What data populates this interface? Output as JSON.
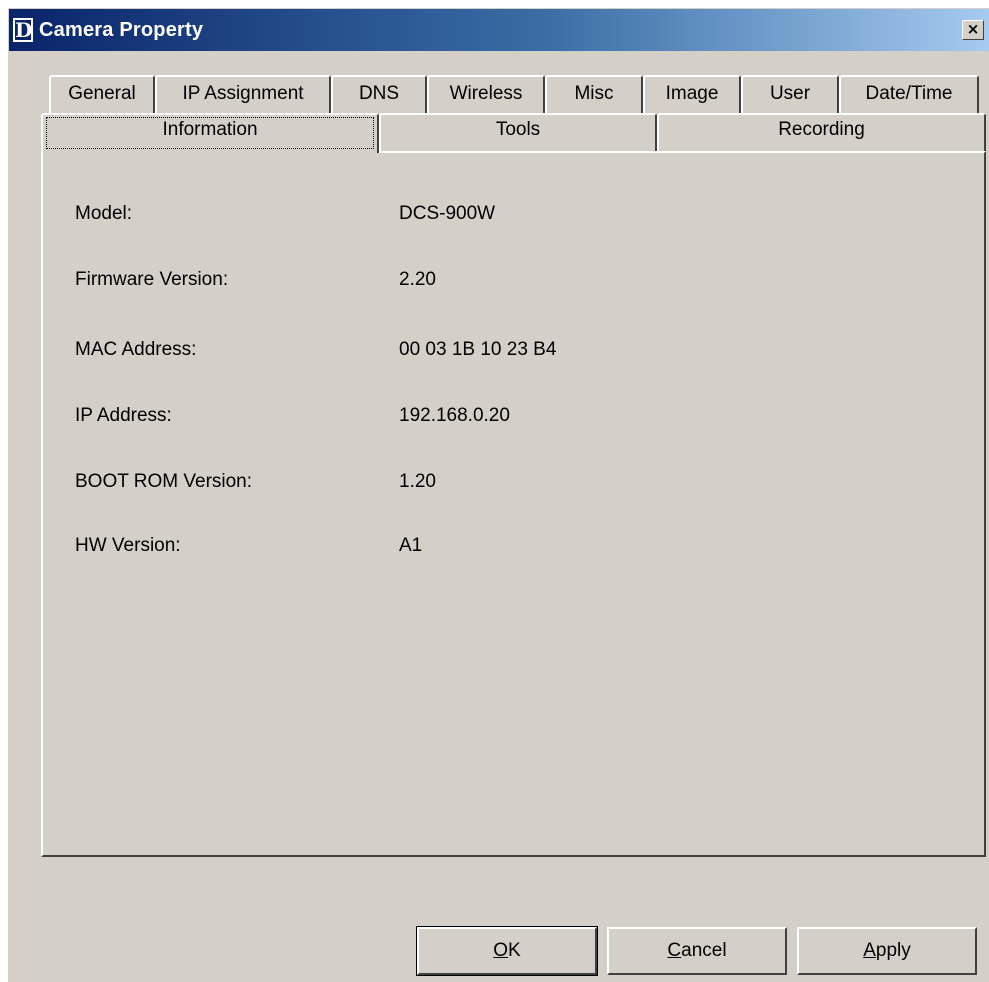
{
  "window": {
    "title": "Camera Property",
    "app_icon_letter": "D",
    "close_glyph": "×"
  },
  "tabs_row1": [
    "General",
    "IP Assignment",
    "DNS",
    "Wireless",
    "Misc",
    "Image",
    "User",
    "Date/Time"
  ],
  "tabs_row2": [
    "Information",
    "Tools",
    "Recording"
  ],
  "active_tab": "Information",
  "info": {
    "model_label": "Model:",
    "model_value": "DCS-900W",
    "firmware_label": "Firmware Version:",
    "firmware_value": "2.20",
    "mac_label": "MAC Address:",
    "mac_value": "00 03 1B 10 23 B4",
    "ip_label": "IP Address:",
    "ip_value": "192.168.0.20",
    "bootrom_label": "BOOT ROM Version:",
    "bootrom_value": "1.20",
    "hw_label": "HW Version:",
    "hw_value": "A1"
  },
  "buttons": {
    "ok_mnemonic": "O",
    "ok_rest": "K",
    "cancel_mnemonic": "C",
    "cancel_rest": "ancel",
    "apply_mnemonic": "A",
    "apply_rest": "pply"
  },
  "icons": {
    "app_icon": "dlink-d-icon",
    "close": "close-icon"
  },
  "colors": {
    "titlebar_start": "#0a246a",
    "titlebar_end": "#a6caf0",
    "face": "#d4d0c8"
  }
}
